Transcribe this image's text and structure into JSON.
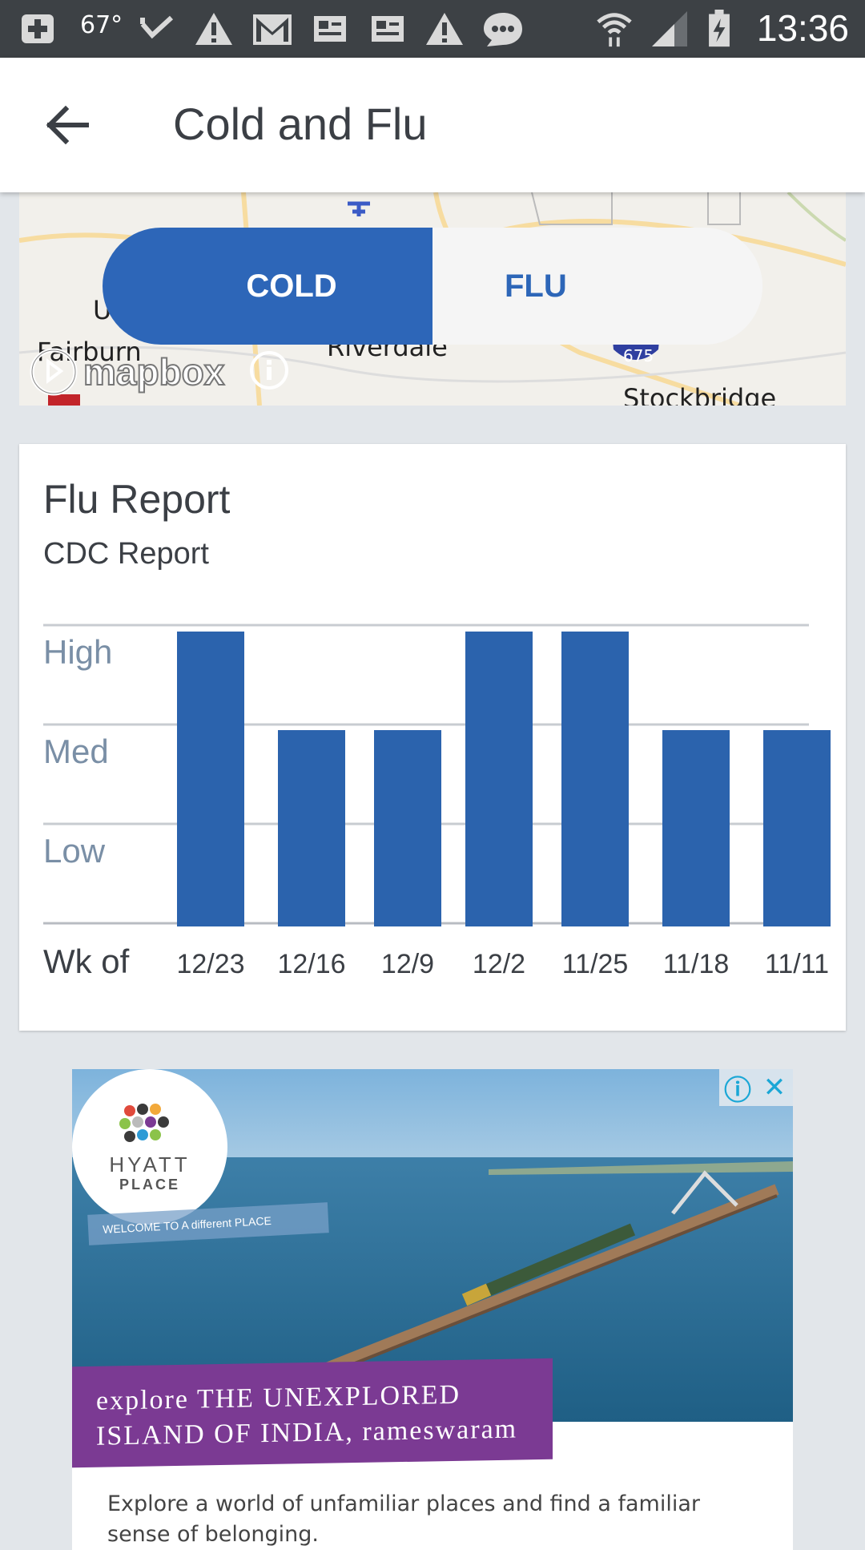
{
  "status_bar": {
    "temperature": "67°",
    "time": "13:36",
    "icons": [
      "add-icon",
      "check-icon",
      "warning-icon",
      "gmail-icon",
      "news-icon",
      "news-icon",
      "warning-icon",
      "chat-icon",
      "wifi-icon",
      "signal-icon",
      "battery-icon"
    ]
  },
  "app_bar": {
    "title": "Cold and Flu",
    "back_icon": "arrow-back-icon"
  },
  "map": {
    "labels": {
      "fairburn": "Fairburn",
      "riverdale": "Riverdale",
      "stockbridge": "Stockbridge",
      "u_label": "U",
      "highway": "675"
    },
    "attribution": "mapbox",
    "toggle": {
      "cold_label": "COLD",
      "flu_label": "FLU",
      "selected": "COLD"
    }
  },
  "report": {
    "title": "Flu Report",
    "subtitle": "CDC Report"
  },
  "chart_data": {
    "type": "bar",
    "levels": [
      "Low",
      "Med",
      "High"
    ],
    "x_title": "Wk of",
    "categories": [
      "12/23",
      "12/16",
      "12/9",
      "12/2",
      "11/25",
      "11/18",
      "11/11"
    ],
    "values": [
      3,
      2,
      2,
      3,
      3,
      2,
      2
    ],
    "ylim": [
      0,
      3
    ],
    "color": "#2b63ad",
    "grid": true
  },
  "ad": {
    "brand": "HYATT",
    "brand_sub": "PLACE",
    "tagline": "WELCOME TO A different PLACE",
    "headline_line1": "explore THE UNEXPLORED",
    "headline_line2": "ISLAND OF INDIA, rameswaram",
    "description": "Explore a world of unfamiliar places and find a familiar sense of belonging.",
    "info_icon": "info-icon",
    "close_icon": "close-icon"
  }
}
